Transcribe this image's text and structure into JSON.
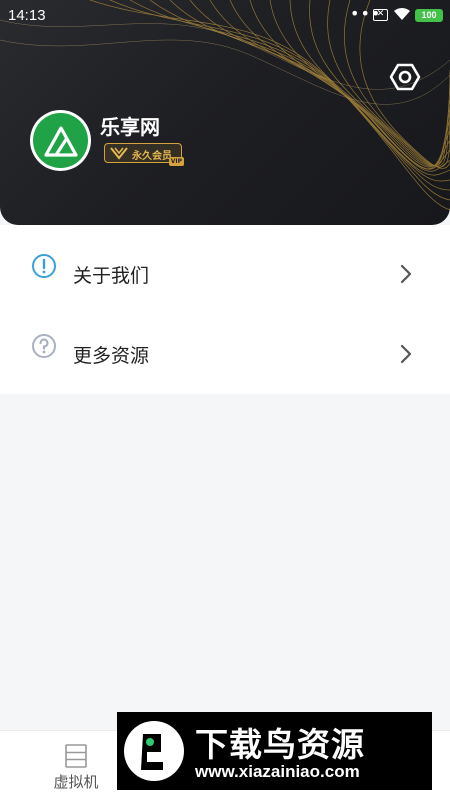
{
  "status_bar": {
    "time": "14:13",
    "more_dots": "•••",
    "sim_icon": "sim-x-icon",
    "battery": "100"
  },
  "profile": {
    "name": "乐享网",
    "vip_label": "永久会员",
    "vip_tag": "VIP"
  },
  "menu": {
    "items": [
      {
        "label": "关于我们",
        "icon": "info-icon"
      },
      {
        "label": "更多资源",
        "icon": "help-icon"
      }
    ]
  },
  "bottom_nav": {
    "items": [
      {
        "label": "虚拟机",
        "icon": "server-icon"
      }
    ]
  },
  "watermark": {
    "title": "下载鸟资源",
    "url": "www.xiazainiao.com"
  },
  "colors": {
    "header_bg": "#1e1f23",
    "accent_gold": "#d4a33d",
    "avatar_green": "#1fa346",
    "battery_green": "#43c24a",
    "info_blue": "#3aa0d8",
    "help_gray": "#a9b0c0"
  }
}
